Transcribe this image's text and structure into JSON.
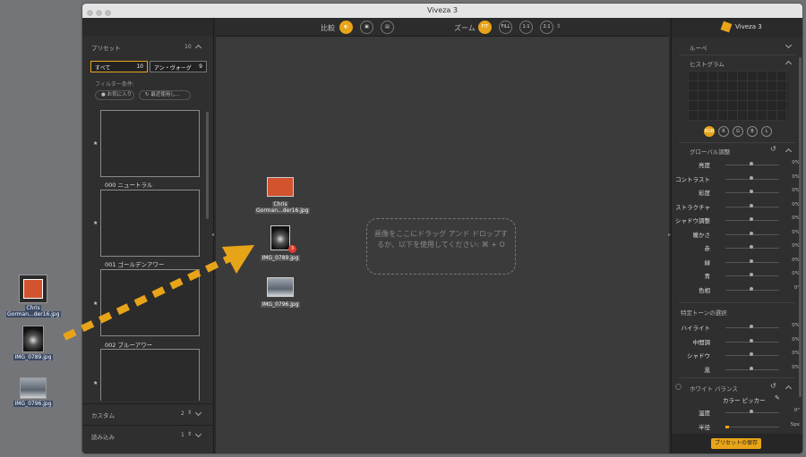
{
  "window": {
    "title": "Viveza 3"
  },
  "desktop": {
    "files": [
      {
        "name_line1": "Chris",
        "name_line2": "Gorman...der16.jpg"
      },
      {
        "name_line1": "IMG_0789.jpg",
        "name_line2": ""
      },
      {
        "name_line1": "IMG_0796.jpg",
        "name_line2": ""
      }
    ]
  },
  "left_panel": {
    "header": "プリセット",
    "header_count": "10",
    "tabs": [
      {
        "label": "すべて",
        "count": "10"
      },
      {
        "label": "アン・ヴォーグ",
        "count": "9"
      }
    ],
    "filter_label": "フィルター条件:",
    "filters": [
      "お気に入り",
      "最近使用し..."
    ],
    "presets": [
      {
        "name": "000 ニュートラル"
      },
      {
        "name": "001 ゴールデンアワー"
      },
      {
        "name": "002 ブルーアワー"
      },
      {
        "name": ""
      }
    ],
    "custom": {
      "label": "カスタム",
      "count": "2"
    },
    "imported": {
      "label": "読み込み",
      "count": "1"
    }
  },
  "toolbar": {
    "compare_label": "比較",
    "zoom_label": "ズーム",
    "zoom_buttons": [
      "FIT",
      "FILL",
      "1:1",
      "2:1"
    ]
  },
  "center": {
    "drop_text": "画像をここにドラッグ アンド ドロップするか、以下を使用してください: ⌘ + O",
    "drag_badge": "3",
    "drag_files": [
      {
        "line1": "Chris",
        "line2": "Gorman...der16.jpg"
      },
      {
        "line1": "IMG_0789.jpg",
        "line2": ""
      },
      {
        "line1": "IMG_0796.jpg",
        "line2": ""
      }
    ]
  },
  "right_panel": {
    "app_title": "Viveza 3",
    "loupe": "ルーペ",
    "histogram": "ヒストグラム",
    "channels": [
      "RGB",
      "R",
      "G",
      "B",
      "L"
    ],
    "global_adjust": "グローバル調整",
    "global_sliders": [
      {
        "label": "亮度",
        "value": "0%"
      },
      {
        "label": "コントラスト",
        "value": "0%"
      },
      {
        "label": "彩度",
        "value": "0%"
      },
      {
        "label": "ストラクチャ",
        "value": "0%"
      },
      {
        "label": "シャドウ調整",
        "value": "0%"
      },
      {
        "label": "暖かさ",
        "value": "0%"
      },
      {
        "label": "赤",
        "value": "0%"
      },
      {
        "label": "緑",
        "value": "0%"
      },
      {
        "label": "青",
        "value": "0%"
      },
      {
        "label": "色相",
        "value": "0°"
      }
    ],
    "tone_select": "特定トーンの選択",
    "tone_sliders": [
      {
        "label": "ハイライト",
        "value": "0%"
      },
      {
        "label": "中間調",
        "value": "0%"
      },
      {
        "label": "シャドウ",
        "value": "0%"
      },
      {
        "label": "黒",
        "value": "0%"
      }
    ],
    "white_balance": "ホワイト バランス",
    "color_picker": "カラー ピッカー",
    "temperature": {
      "label": "温度",
      "value": "0°"
    },
    "radius": {
      "label": "半径",
      "value": "5px"
    },
    "save_preset": "プリセットの保存"
  },
  "colors": {
    "accent": "#e8a418",
    "badge": "#e03a2e"
  }
}
